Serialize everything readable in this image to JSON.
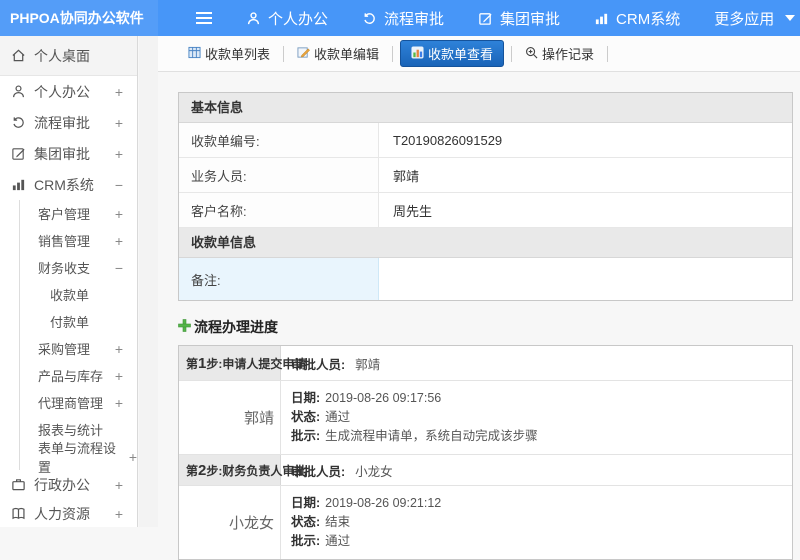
{
  "brand": {
    "title": "PHPOA协同办公软件"
  },
  "topnav": {
    "items": [
      {
        "label": "个人办公",
        "icon": "user-icon"
      },
      {
        "label": "流程审批",
        "icon": "history-icon"
      },
      {
        "label": "集团审批",
        "icon": "edit-icon"
      },
      {
        "label": "CRM系统",
        "icon": "bar-chart-icon"
      },
      {
        "label": "更多应用",
        "icon": "caret-down-icon"
      }
    ]
  },
  "sidebar": {
    "items": [
      {
        "label": "个人桌面",
        "icon": "home-icon",
        "expander": ""
      },
      {
        "label": "个人办公",
        "icon": "user-icon",
        "expander": "+"
      },
      {
        "label": "流程审批",
        "icon": "history-icon",
        "expander": "+"
      },
      {
        "label": "集团审批",
        "icon": "edit-icon",
        "expander": "+"
      },
      {
        "label": "CRM系统",
        "icon": "bar-chart-icon",
        "expander": "−"
      },
      {
        "label": "客户管理",
        "expander": "+"
      },
      {
        "label": "销售管理",
        "expander": "+"
      },
      {
        "label": "财务收支",
        "expander": "−"
      },
      {
        "label": "收款单",
        "expander": ""
      },
      {
        "label": "付款单",
        "expander": ""
      },
      {
        "label": "采购管理",
        "expander": "+"
      },
      {
        "label": "产品与库存",
        "expander": "+"
      },
      {
        "label": "代理商管理",
        "expander": "+"
      },
      {
        "label": "报表与统计",
        "expander": ""
      },
      {
        "label": "表单与流程设置",
        "expander": "+"
      },
      {
        "label": "行政办公",
        "icon": "briefcase-icon",
        "expander": "+"
      },
      {
        "label": "人力资源",
        "icon": "book-icon",
        "expander": "+"
      }
    ]
  },
  "tabs": [
    {
      "label": "收款单列表",
      "icon": "table-icon",
      "active": false
    },
    {
      "label": "收款单编辑",
      "icon": "edit-doc-icon",
      "active": false
    },
    {
      "label": "收款单查看",
      "icon": "view-chart-icon",
      "active": true
    },
    {
      "label": "操作记录",
      "icon": "zoom-plus-icon",
      "active": false
    }
  ],
  "basic_info": {
    "header": "基本信息",
    "rows": [
      {
        "label": "收款单编号:",
        "value": "T20190826091529"
      },
      {
        "label": "业务人员:",
        "value": "郭靖"
      },
      {
        "label": "客户名称:",
        "value": "周先生"
      }
    ]
  },
  "receipt_info": {
    "header": "收款单信息",
    "remark": {
      "label": "备注:",
      "value": ""
    }
  },
  "progress": {
    "title": "流程办理进度",
    "title_icon": "green-plus-icon",
    "steps": [
      {
        "step_prefix": "第",
        "step_num": "1",
        "step_suffix": "步:申请人提交申请",
        "approver_label": "审批人员:",
        "approver": "郭靖",
        "name": "郭靖",
        "date_label": "日期:",
        "date": "2019-08-26 09:17:56",
        "status_label": "状态:",
        "status": "通过",
        "remark_label": "批示:",
        "remark": "生成流程申请单，系统自动完成该步骤"
      },
      {
        "step_prefix": "第",
        "step_num": "2",
        "step_suffix": "步:财务负责人审批",
        "approver_label": "审批人员:",
        "approver": "小龙女",
        "name": "小龙女",
        "date_label": "日期:",
        "date": "2019-08-26 09:21:12",
        "status_label": "状态:",
        "status": "结束",
        "remark_label": "批示:",
        "remark": "通过"
      }
    ]
  },
  "colors": {
    "topbar_blue": "#4796f8",
    "active_tab_blue": "#1a64b8",
    "section_header_gray": "#e9e9e9",
    "remark_blue": "#e9f5fd",
    "plus_green": "#56b54a"
  }
}
